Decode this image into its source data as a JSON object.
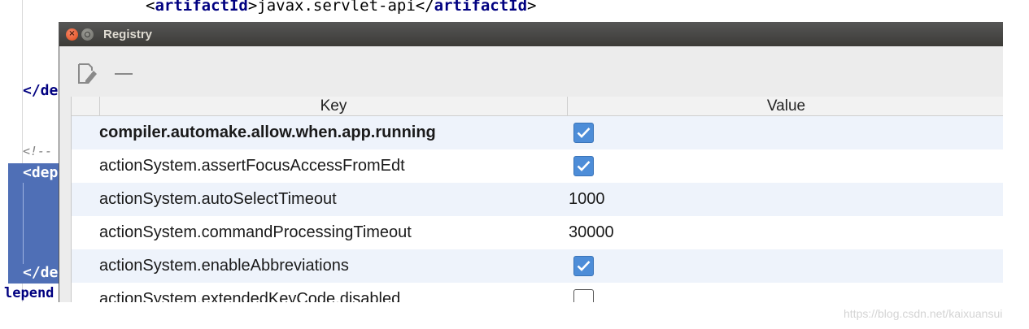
{
  "editor": {
    "top_line_open": "<",
    "top_line_tag1": "artifactId",
    "top_line_close1": ">",
    "top_line_text": "javax.servlet-api",
    "top_line_open2": "</",
    "top_line_tag2": "artifactId",
    "top_line_close2": ">",
    "frag_dep1": "</de",
    "frag_comment": "<!--",
    "frag_dep2": "<dep",
    "frag_dep3": "</de",
    "frag_depend": "lepend"
  },
  "dialog": {
    "title": "Registry",
    "close_glyph": "×",
    "table": {
      "headers": {
        "key": "Key",
        "value": "Value"
      },
      "rows": [
        {
          "key": "compiler.automake.allow.when.app.running",
          "type": "checkbox",
          "checked": true,
          "bold": true
        },
        {
          "key": "actionSystem.assertFocusAccessFromEdt",
          "type": "checkbox",
          "checked": true,
          "bold": false
        },
        {
          "key": "actionSystem.autoSelectTimeout",
          "type": "text",
          "value": "1000",
          "bold": false
        },
        {
          "key": "actionSystem.commandProcessingTimeout",
          "type": "text",
          "value": "30000",
          "bold": false
        },
        {
          "key": "actionSystem.enableAbbreviations",
          "type": "checkbox",
          "checked": true,
          "bold": false
        },
        {
          "key": "actionSystem.extendedKeyCode.disabled",
          "type": "checkbox",
          "checked": false,
          "bold": false
        }
      ]
    }
  },
  "watermark": "https://blog.csdn.net/kaixuansui",
  "colors": {
    "checkbox_on": "#4d8dd8",
    "titlebar": "#3c3b37",
    "selection": "#4f6fb6",
    "row_alt": "#eef3fb"
  }
}
